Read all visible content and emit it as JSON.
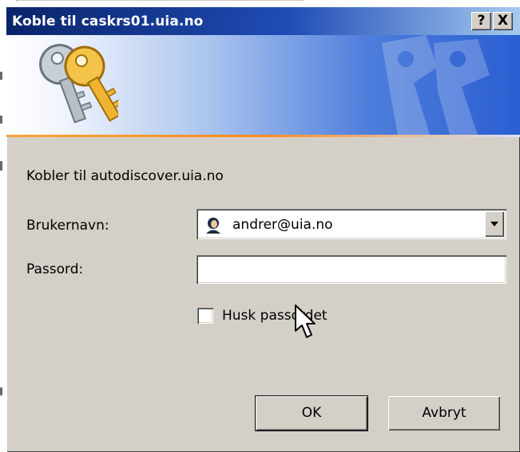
{
  "window": {
    "title": "Koble til caskrs01.uia.no",
    "help_button": "?",
    "close_button": "X"
  },
  "banner": {
    "icon": "keys-icon",
    "watermark": "keys-watermark-icon"
  },
  "connecting_text": "Kobler til autodiscover.uia.no",
  "username": {
    "label": "Brukernavn:",
    "value": "andrer@uia.no",
    "icon": "user-avatar-icon"
  },
  "password": {
    "label": "Passord:",
    "value": ""
  },
  "remember": {
    "label": "Husk passordet",
    "checked": false
  },
  "buttons": {
    "ok": "OK",
    "cancel": "Avbryt"
  },
  "colors": {
    "titlebar_start": "#0a246a",
    "titlebar_end": "#a6caf0",
    "dialog_bg": "#d4d0c8",
    "accent_line": "#ff8b1d"
  }
}
